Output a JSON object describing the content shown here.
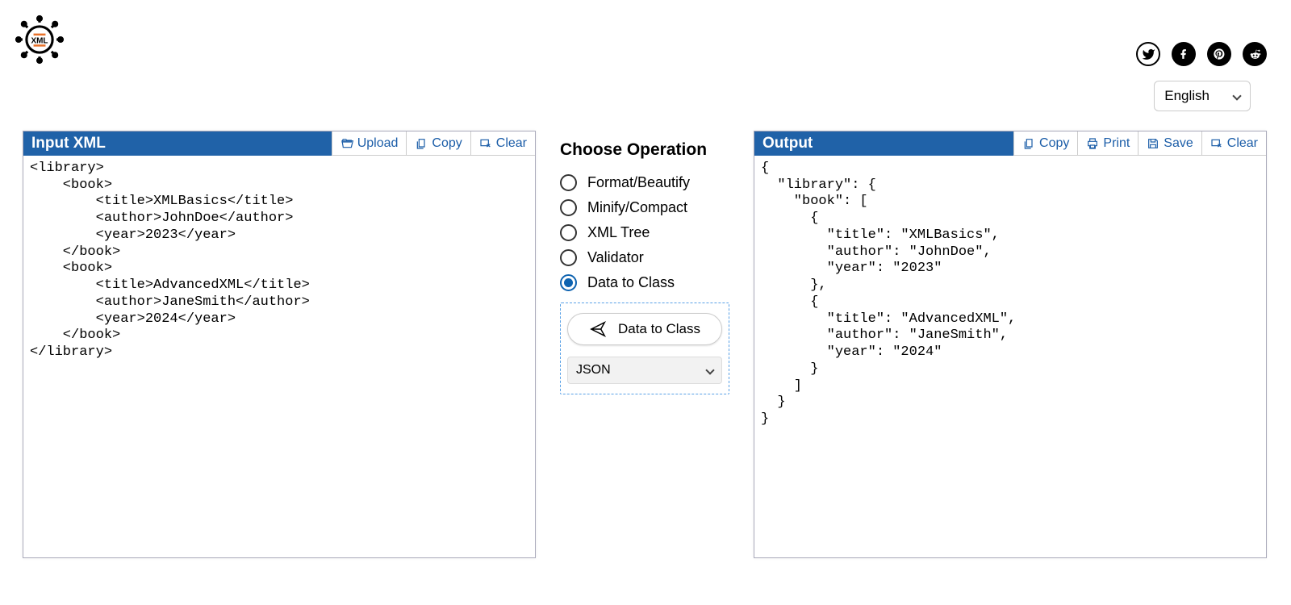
{
  "header": {
    "language": "English"
  },
  "social": {
    "twitter": "twitter",
    "facebook": "facebook",
    "pinterest": "pinterest",
    "reddit": "reddit"
  },
  "input_panel": {
    "title": "Input XML",
    "toolbar": {
      "upload": "Upload",
      "copy": "Copy",
      "clear": "Clear"
    },
    "content": "<library>\n    <book>\n        <title>XMLBasics</title>\n        <author>JohnDoe</author>\n        <year>2023</year>\n    </book>\n    <book>\n        <title>AdvancedXML</title>\n        <author>JaneSmith</author>\n        <year>2024</year>\n    </book>\n</library>"
  },
  "output_panel": {
    "title": "Output",
    "toolbar": {
      "copy": "Copy",
      "print": "Print",
      "save": "Save",
      "clear": "Clear"
    },
    "content": "{\n  \"library\": {\n    \"book\": [\n      {\n        \"title\": \"XMLBasics\",\n        \"author\": \"JohnDoe\",\n        \"year\": \"2023\"\n      },\n      {\n        \"title\": \"AdvancedXML\",\n        \"author\": \"JaneSmith\",\n        \"year\": \"2024\"\n      }\n    ]\n  }\n}"
  },
  "operations": {
    "heading": "Choose Operation",
    "options": {
      "format": "Format/Beautify",
      "minify": "Minify/Compact",
      "tree": "XML Tree",
      "validator": "Validator",
      "dataclass": "Data to Class"
    },
    "selected": "dataclass",
    "action_label": "Data to Class",
    "format_select": "JSON"
  }
}
